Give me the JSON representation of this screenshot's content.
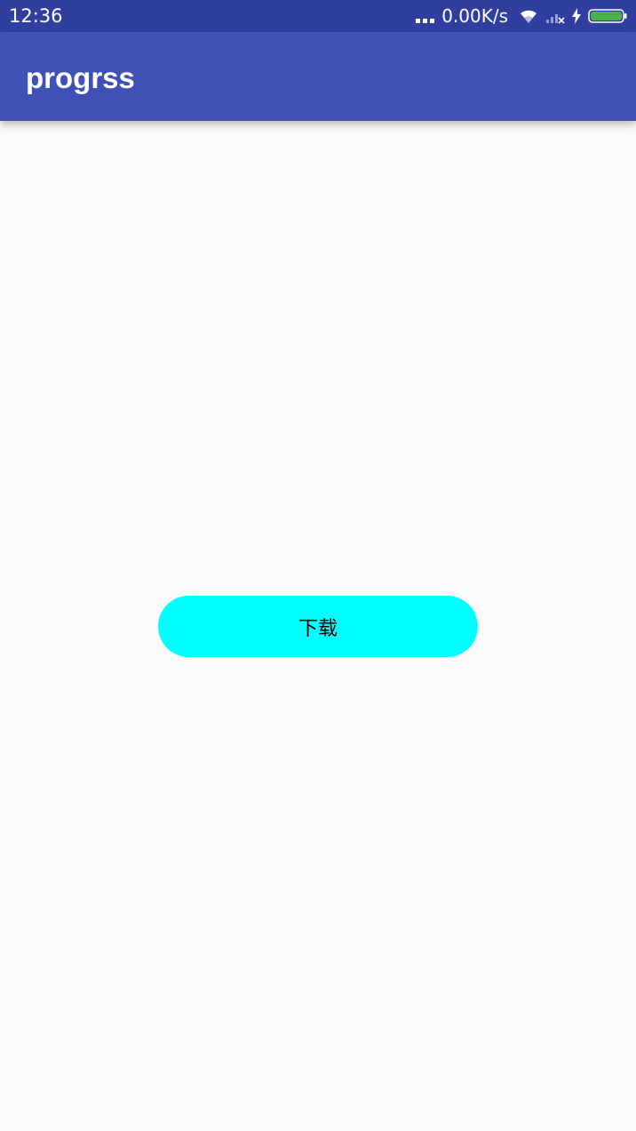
{
  "status_bar": {
    "time": "12:36",
    "net_speed": "0.00K/s",
    "icons": [
      "more-dots-icon",
      "wifi-icon",
      "signal-no-sim-icon",
      "charging-bolt-icon",
      "battery-icon"
    ],
    "battery_color": "#4caf50"
  },
  "app_bar": {
    "title": "progrss",
    "color": "#3f51b5",
    "status_color": "#303f9f"
  },
  "main": {
    "download_button_label": "下载",
    "download_button_color": "#00ffff"
  }
}
